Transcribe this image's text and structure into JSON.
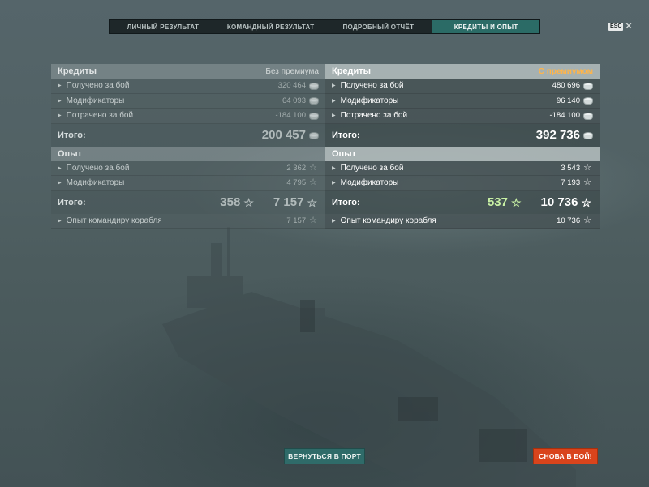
{
  "tabs": [
    {
      "label": "ЛИЧНЫЙ РЕЗУЛЬТАТ",
      "active": false
    },
    {
      "label": "КОМАНДНЫЙ РЕЗУЛЬТАТ",
      "active": false
    },
    {
      "label": "ПОДРОБНЫЙ ОТЧЁТ",
      "active": false
    },
    {
      "label": "КРЕДИТЫ И ОПЫТ",
      "active": true
    }
  ],
  "esc_label": "ESC",
  "left": {
    "credits": {
      "title": "Кредиты",
      "subtitle": "Без премиума",
      "rows": [
        {
          "label": "Получено за бой",
          "value": "320 464"
        },
        {
          "label": "Модификаторы",
          "value": "64 093"
        },
        {
          "label": "Потрачено за бой",
          "value": "-184 100"
        }
      ],
      "total_label": "Итого:",
      "total_value": "200 457"
    },
    "xp": {
      "title": "Опыт",
      "rows": [
        {
          "label": "Получено за бой",
          "value": "2 362"
        },
        {
          "label": "Модификаторы",
          "value": "4 795"
        }
      ],
      "total_label": "Итого:",
      "free_xp": "358",
      "total_value": "7 157",
      "commander_label": "Опыт командиру корабля",
      "commander_value": "7 157"
    }
  },
  "right": {
    "credits": {
      "title": "Кредиты",
      "subtitle": "С премиумом",
      "rows": [
        {
          "label": "Получено за бой",
          "value": "480 696"
        },
        {
          "label": "Модификаторы",
          "value": "96 140"
        },
        {
          "label": "Потрачено за бой",
          "value": "-184 100"
        }
      ],
      "total_label": "Итого:",
      "total_value": "392 736"
    },
    "xp": {
      "title": "Опыт",
      "rows": [
        {
          "label": "Получено за бой",
          "value": "3 543"
        },
        {
          "label": "Модификаторы",
          "value": "7 193"
        }
      ],
      "total_label": "Итого:",
      "free_xp": "537",
      "total_value": "10 736",
      "commander_label": "Опыт командиру корабля",
      "commander_value": "10 736"
    }
  },
  "buttons": {
    "port": "ВЕРНУТЬСЯ В ПОРТ",
    "battle": "СНОВА В БОЙ!"
  },
  "icons": {
    "credit": "credit-coin-icon",
    "xp": "star-icon",
    "row_marker": "triangle-right-icon",
    "close": "close-icon"
  },
  "colors": {
    "accent_tab": "#2b6b66",
    "premium": "#ffb54a",
    "battle_button": "#d9441c",
    "port_button": "#2f6b69",
    "free_xp": "#c8f0a4"
  }
}
